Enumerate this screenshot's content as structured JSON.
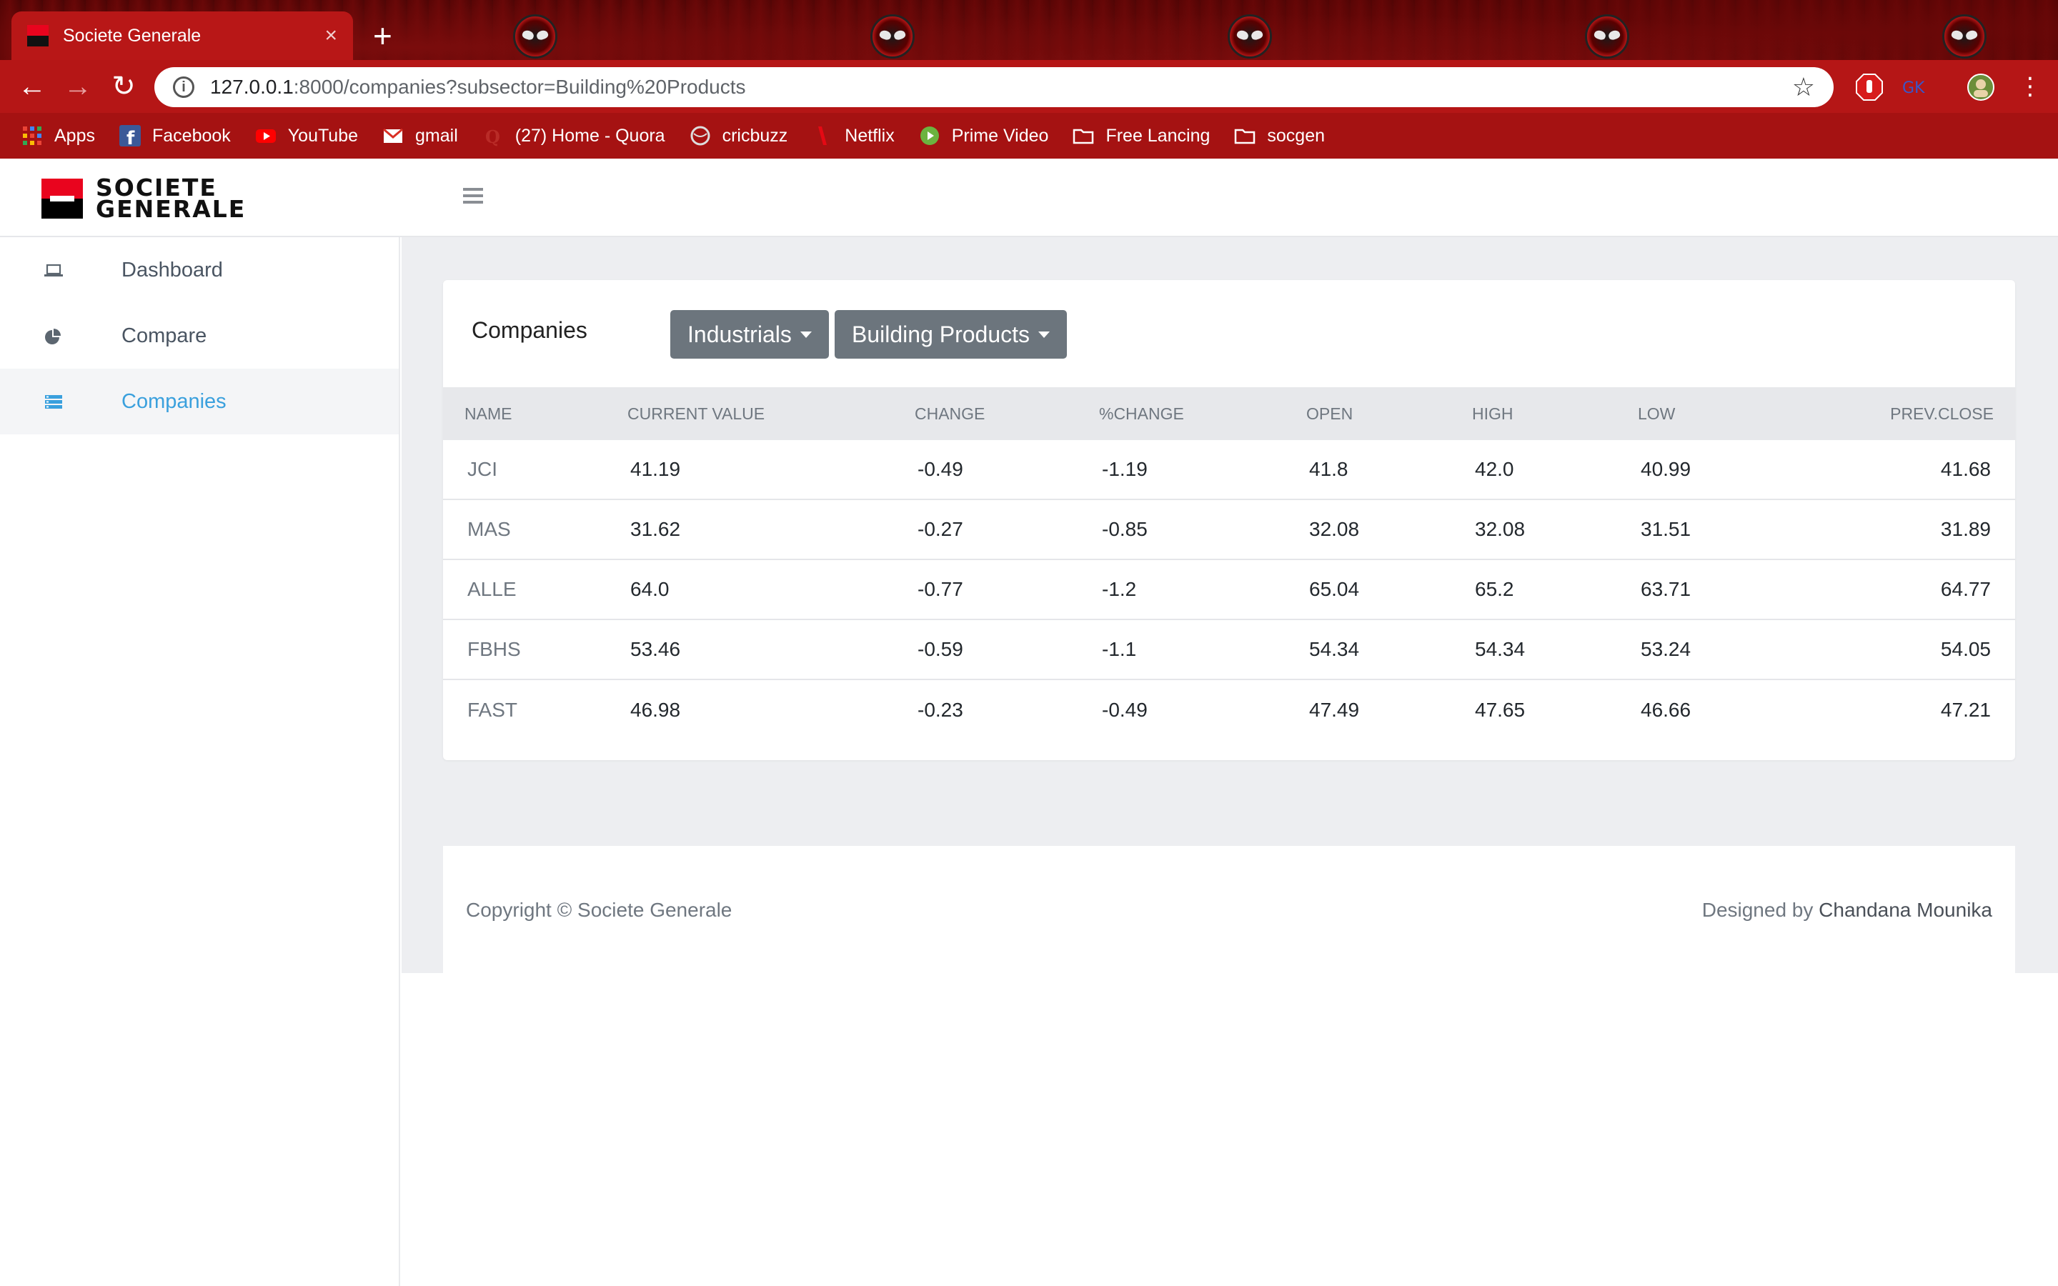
{
  "browser": {
    "tab_title": "Societe Generale",
    "tab_close": "×",
    "new_tab": "+",
    "url_host": "127.0.0.1",
    "url_rest": ":8000/companies?subsector=Building%20Products",
    "bookmarks": [
      {
        "label": "Apps",
        "icon": "apps-grid-icon"
      },
      {
        "label": "Facebook",
        "icon": "facebook-icon"
      },
      {
        "label": "YouTube",
        "icon": "youtube-icon"
      },
      {
        "label": "gmail",
        "icon": "gmail-icon"
      },
      {
        "label": "(27) Home - Quora",
        "icon": "quora-icon"
      },
      {
        "label": "cricbuzz",
        "icon": "cricbuzz-icon"
      },
      {
        "label": "Netflix",
        "icon": "netflix-icon"
      },
      {
        "label": "Prime Video",
        "icon": "prime-video-icon"
      },
      {
        "label": "Free Lancing",
        "icon": "folder-icon"
      },
      {
        "label": "socgen",
        "icon": "folder-icon"
      }
    ]
  },
  "app": {
    "logo_line1": "SOCIETE",
    "logo_line2": "GENERALE"
  },
  "sidebar": {
    "items": [
      {
        "label": "Dashboard",
        "icon": "laptop-icon",
        "active": false
      },
      {
        "label": "Compare",
        "icon": "pie-chart-icon",
        "active": false
      },
      {
        "label": "Companies",
        "icon": "list-icon",
        "active": true
      }
    ]
  },
  "card": {
    "title": "Companies",
    "sector_dropdown": "Industrials",
    "subsector_dropdown": "Building Products"
  },
  "table": {
    "headers": [
      "NAME",
      "CURRENT VALUE",
      "CHANGE",
      "%CHANGE",
      "OPEN",
      "HIGH",
      "LOW",
      "PREV.CLOSE"
    ],
    "rows": [
      [
        "JCI",
        "41.19",
        "-0.49",
        "-1.19",
        "41.8",
        "42.0",
        "40.99",
        "41.68"
      ],
      [
        "MAS",
        "31.62",
        "-0.27",
        "-0.85",
        "32.08",
        "32.08",
        "31.51",
        "31.89"
      ],
      [
        "ALLE",
        "64.0",
        "-0.77",
        "-1.2",
        "65.04",
        "65.2",
        "63.71",
        "64.77"
      ],
      [
        "FBHS",
        "53.46",
        "-0.59",
        "-1.1",
        "54.34",
        "54.34",
        "53.24",
        "54.05"
      ],
      [
        "FAST",
        "46.98",
        "-0.23",
        "-0.49",
        "47.49",
        "47.65",
        "46.66",
        "47.21"
      ]
    ]
  },
  "footer": {
    "copyright": "Copyright © Societe Generale",
    "designed_by": "Designed by ",
    "author": "Chandana Mounika"
  },
  "colors": {
    "accent_active": "#3aa0dd",
    "brand_red": "#e9041e",
    "dropdown_bg": "#6c757d"
  }
}
